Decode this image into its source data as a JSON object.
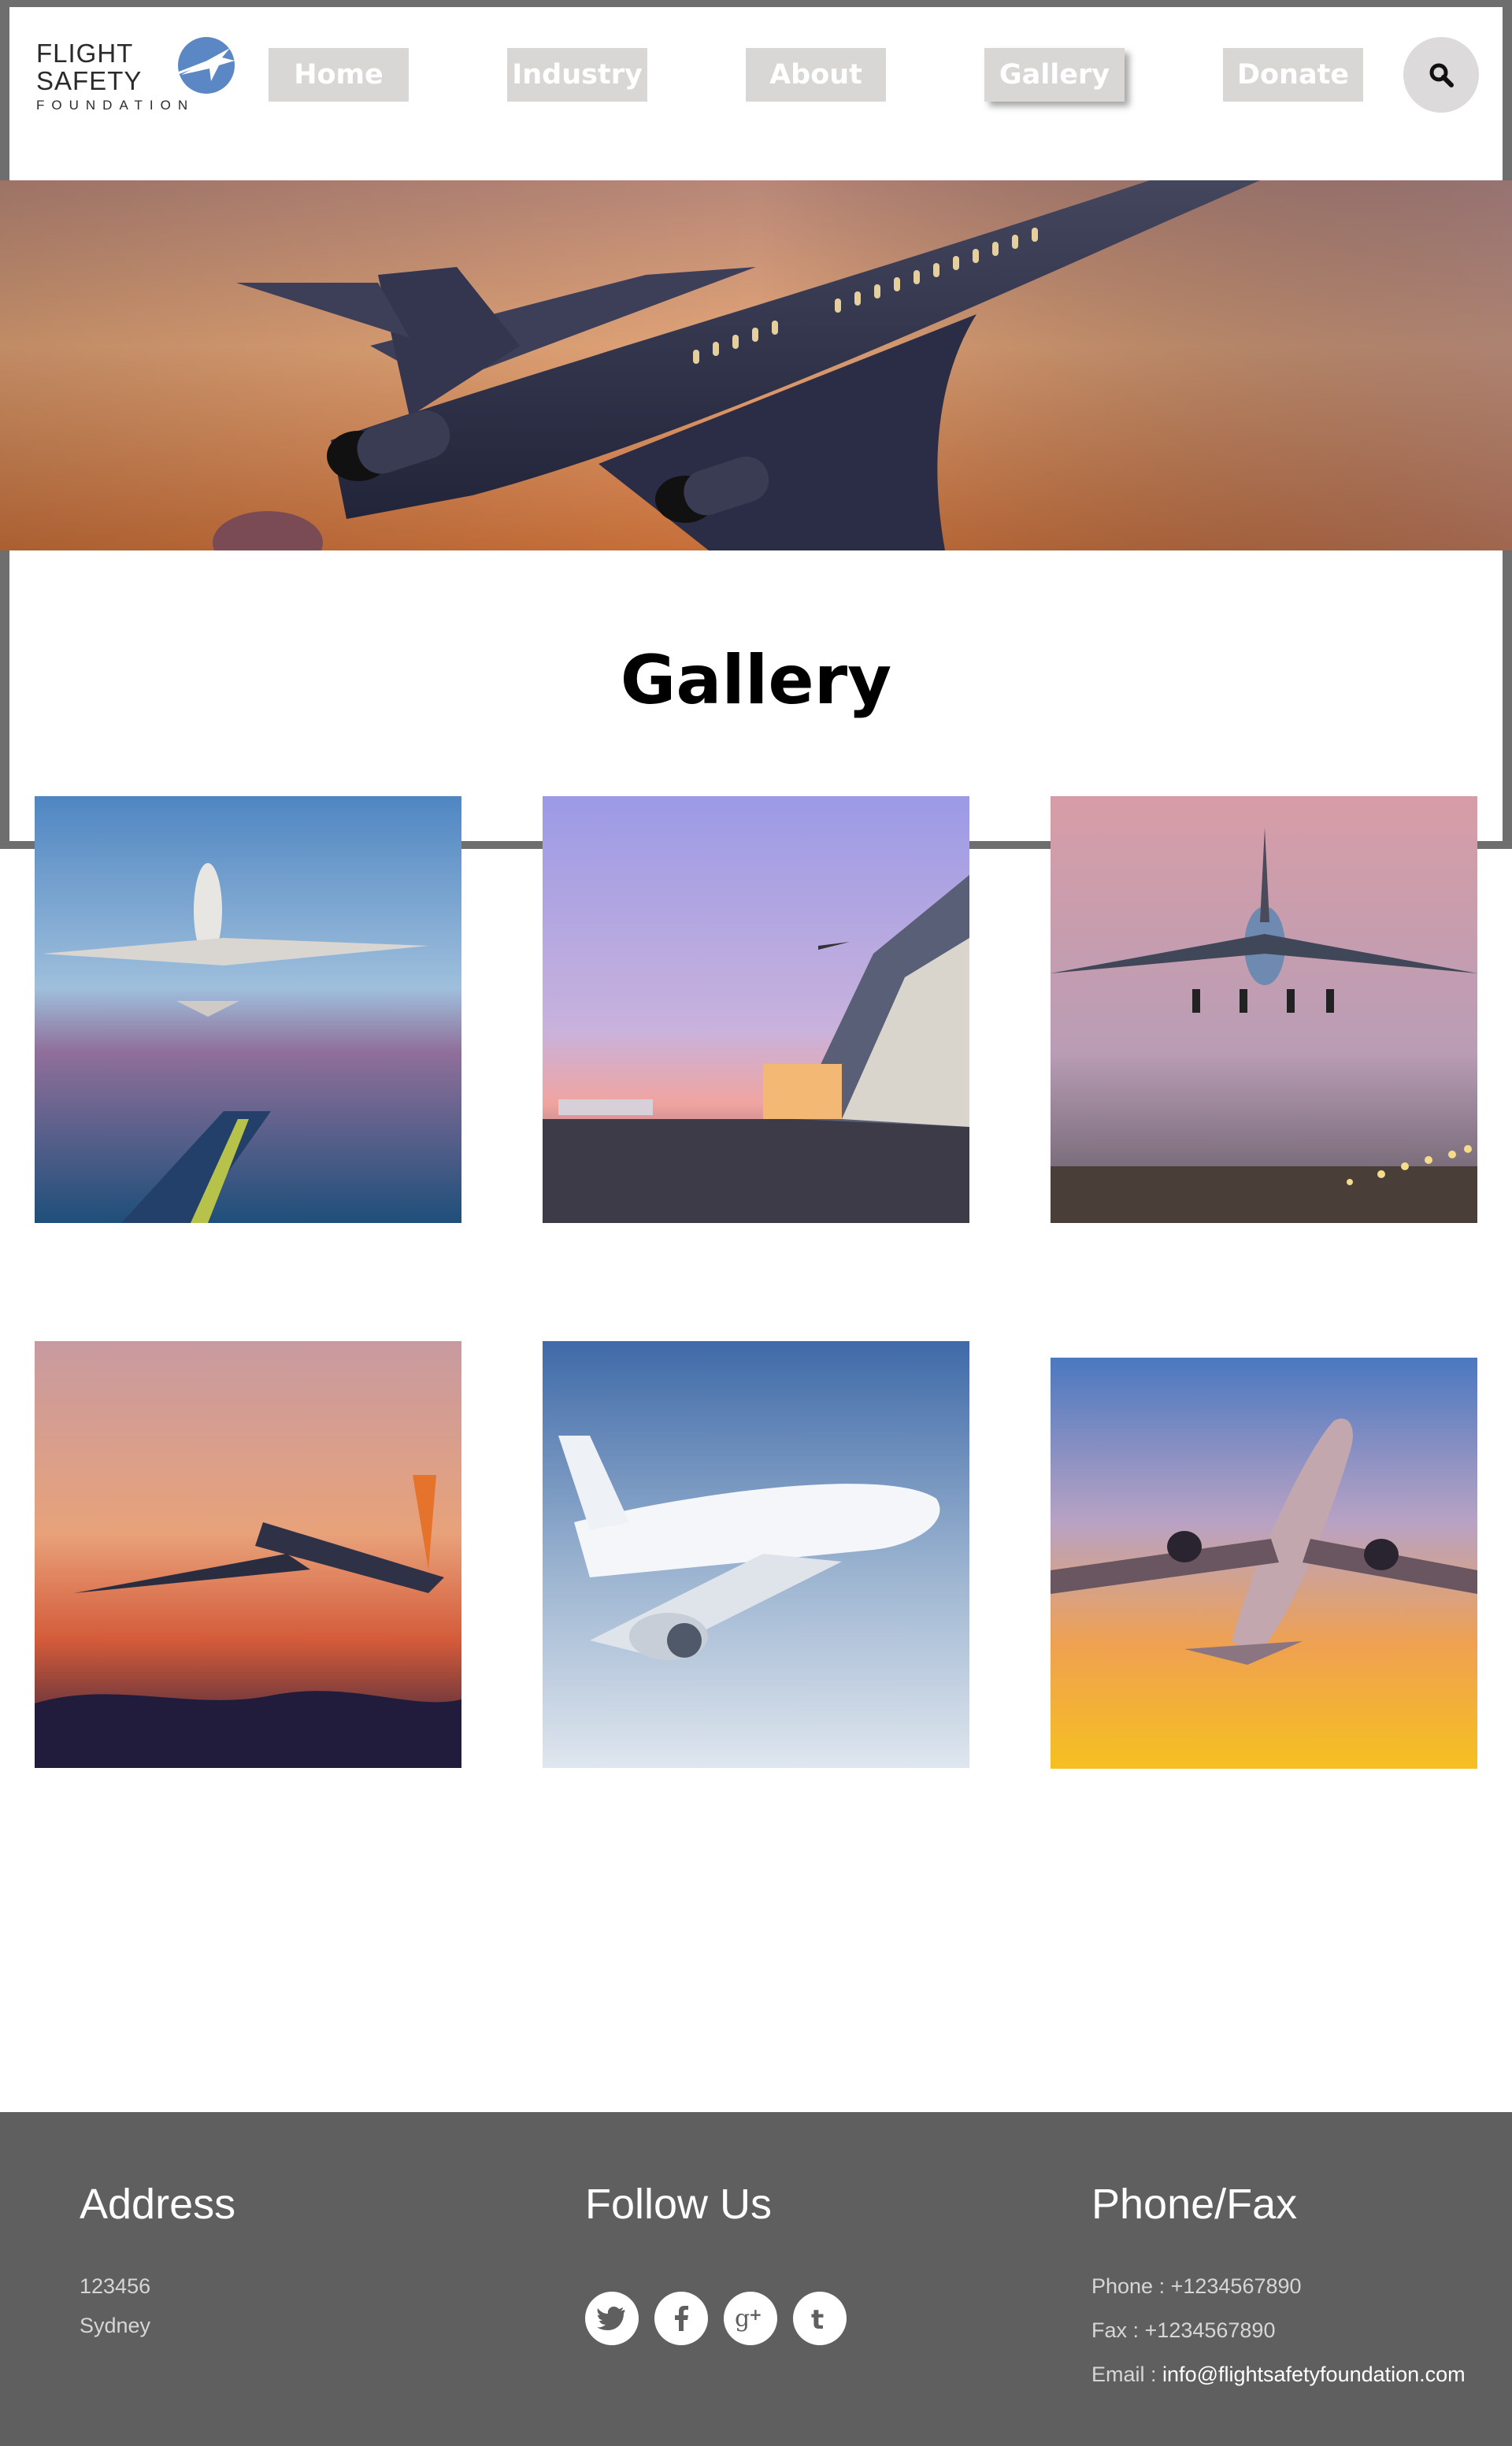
{
  "logo": {
    "line1": "FLIGHT",
    "line2": "SAFETY",
    "line3": "FOUNDATION"
  },
  "nav": {
    "items": [
      {
        "label": "Home"
      },
      {
        "label": "Industry"
      },
      {
        "label": "About"
      },
      {
        "label": "Gallery",
        "active": true
      },
      {
        "label": "Donate"
      }
    ],
    "search_icon": "search-icon"
  },
  "gallery": {
    "title": "Gallery",
    "photos": [
      {
        "name": "plane-over-runway-blue-sky"
      },
      {
        "name": "airport-hangar-dusk"
      },
      {
        "name": "jumbo-jet-landing"
      },
      {
        "name": "plane-sunset-takeoff"
      },
      {
        "name": "white-airliner-cloudy-sky"
      },
      {
        "name": "airliner-golden-sunset"
      }
    ]
  },
  "footer": {
    "address": {
      "heading": "Address",
      "line1": "123456",
      "line2": "Sydney"
    },
    "follow": {
      "heading": "Follow Us",
      "icons": [
        "twitter-icon",
        "facebook-icon",
        "google-plus-icon",
        "tumblr-icon"
      ]
    },
    "contact": {
      "heading": "Phone/Fax",
      "phone_label": "Phone :",
      "phone_value": "+1234567890",
      "fax_label": "Fax :",
      "fax_value": "+1234567890",
      "email_label": "Email :",
      "email_value": "info@flightsafetyfoundation.com"
    }
  },
  "colors": {
    "frame": "#6e6e6e",
    "nav_button": "#d9d6d6",
    "footer_bg": "#5f5f5f",
    "logo_accent": "#5b87c4"
  }
}
